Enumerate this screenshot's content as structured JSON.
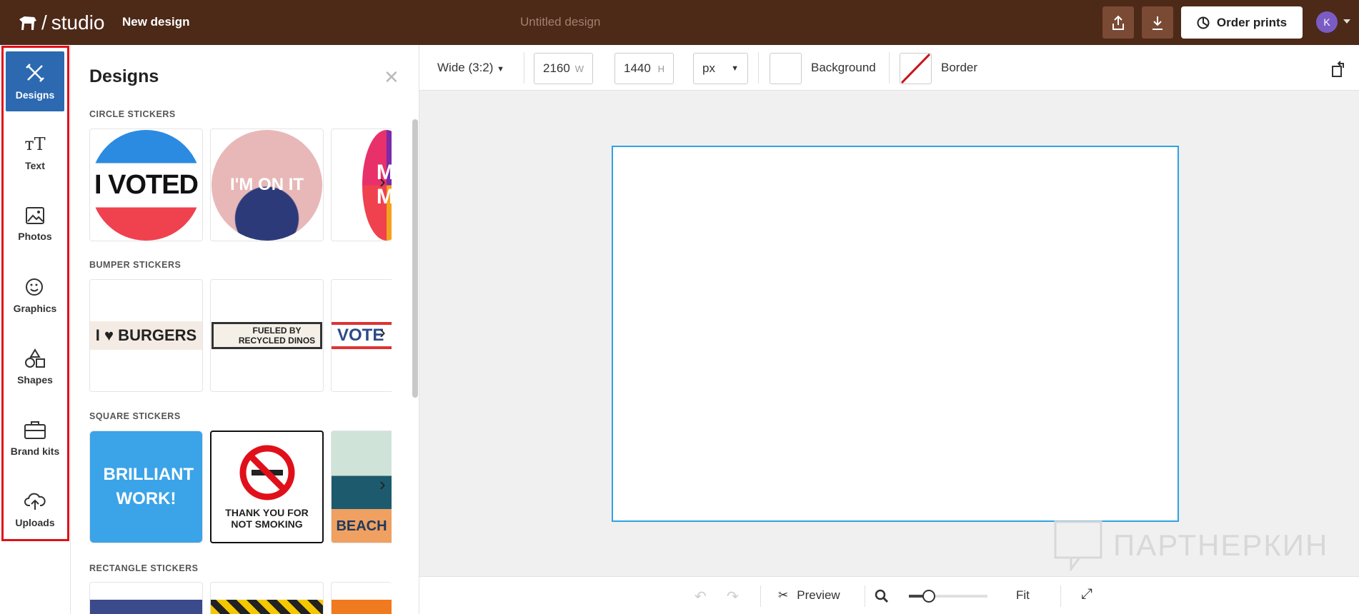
{
  "header": {
    "logo_text": "studio",
    "new_design": "New design",
    "doc_title": "Untitled design",
    "order_prints": "Order prints",
    "avatar_initial": "K"
  },
  "nav": {
    "items": [
      {
        "label": "Designs",
        "icon": "designs-icon"
      },
      {
        "label": "Text",
        "icon": "text-icon"
      },
      {
        "label": "Photos",
        "icon": "image-icon"
      },
      {
        "label": "Graphics",
        "icon": "smiley-icon"
      },
      {
        "label": "Shapes",
        "icon": "shapes-icon"
      },
      {
        "label": "Brand kits",
        "icon": "briefcase-icon"
      },
      {
        "label": "Uploads",
        "icon": "cloud-upload-icon"
      }
    ]
  },
  "panel": {
    "title": "Designs",
    "sections": [
      {
        "label": "CIRCLE STICKERS",
        "items": [
          "I VOTED",
          "I'M ON IT",
          "MA MO"
        ]
      },
      {
        "label": "BUMPER STICKERS",
        "items": [
          "I ♥ BURGERS",
          "FUELED BY RECYCLED DINOS",
          "VOTE"
        ]
      },
      {
        "label": "SQUARE STICKERS",
        "items": [
          "BRILLIANT WORK!",
          "THANK YOU FOR NOT SMOKING",
          "BEACH"
        ]
      },
      {
        "label": "RECTANGLE STICKERS",
        "items": [
          "",
          "",
          ""
        ]
      }
    ]
  },
  "toolbar": {
    "preset": "Wide (3:2)",
    "width": "2160",
    "width_unit": "W",
    "height": "1440",
    "height_unit": "H",
    "units": "px",
    "background": "Background",
    "border": "Border"
  },
  "bottom": {
    "preview": "Preview",
    "fit": "Fit",
    "zoom_fraction": 0.25
  },
  "watermark": "ПАРТНЕРКИН",
  "colors": {
    "header": "#4d2918",
    "accent": "#2c69b0",
    "artboard_border": "#2ea3df"
  }
}
